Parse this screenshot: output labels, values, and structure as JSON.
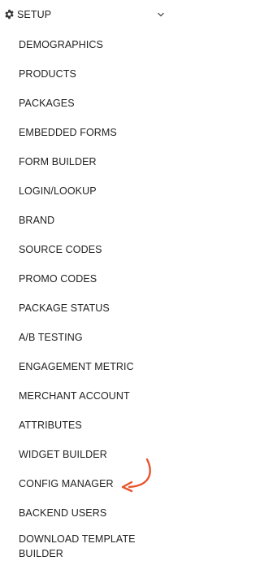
{
  "header": {
    "icon": "gear-icon",
    "label": "SETUP",
    "chevron_icon": "chevron-down-icon"
  },
  "items": [
    {
      "label": "DEMOGRAPHICS"
    },
    {
      "label": "PRODUCTS"
    },
    {
      "label": "PACKAGES"
    },
    {
      "label": "EMBEDDED FORMS"
    },
    {
      "label": "FORM BUILDER"
    },
    {
      "label": "LOGIN/LOOKUP"
    },
    {
      "label": "BRAND"
    },
    {
      "label": "SOURCE CODES"
    },
    {
      "label": "PROMO CODES"
    },
    {
      "label": "PACKAGE STATUS"
    },
    {
      "label": "A/B TESTING"
    },
    {
      "label": "ENGAGEMENT METRIC"
    },
    {
      "label": "MERCHANT ACCOUNT"
    },
    {
      "label": "ATTRIBUTES"
    },
    {
      "label": "WIDGET BUILDER"
    },
    {
      "label": "CONFIG MANAGER"
    },
    {
      "label": "BACKEND USERS"
    },
    {
      "label": "DOWNLOAD TEMPLATE BUILDER"
    }
  ],
  "annotation": {
    "icon": "curved-arrow-icon",
    "color": "#e8542c"
  }
}
